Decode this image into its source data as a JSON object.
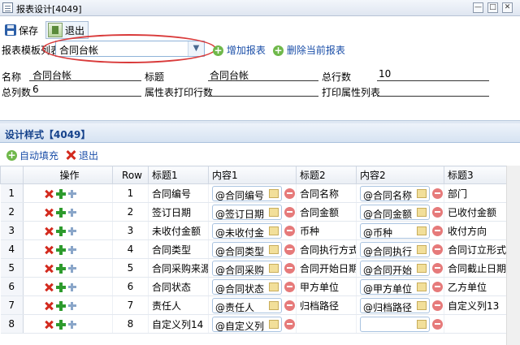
{
  "window": {
    "title": "报表设计[4049]",
    "controls": [
      "—",
      "□",
      "✕"
    ]
  },
  "toolbar": {
    "save_label": "保存",
    "exit_label": "退出"
  },
  "template": {
    "label": "报表模板列表",
    "selected": "合同台帐",
    "add_label": "增加报表",
    "delete_label": "删除当前报表"
  },
  "fields": {
    "name_label": "名称",
    "name_value": "合同台帐",
    "title_label": "标题",
    "title_value": "合同台帐",
    "total_rows_label": "总行数",
    "total_rows_value": "10",
    "total_cols_label": "总列数",
    "total_cols_value": "6",
    "prop_print_rows_label": "属性表打印行数",
    "prop_print_rows_value": "",
    "print_prop_list_label": "打印属性列表",
    "print_prop_list_value": ""
  },
  "design": {
    "header": "设计样式【4049】",
    "autofill_label": "自动填充",
    "exit_label": "退出",
    "columns": [
      "操作",
      "Row",
      "标题1",
      "内容1",
      "标题2",
      "内容2",
      "标题3"
    ],
    "rows": [
      {
        "n": "1",
        "row": "1",
        "t1": "合同编号",
        "c1": "@合同编号",
        "t2": "合同名称",
        "c2": "@合同名称",
        "t3": "部门"
      },
      {
        "n": "2",
        "row": "2",
        "t1": "签订日期",
        "c1": "@签订日期",
        "t2": "合同金额",
        "c2": "@合同金额",
        "t3": "已收付金额"
      },
      {
        "n": "3",
        "row": "3",
        "t1": "未收付金额",
        "c1": "@未收付金",
        "t2": "币种",
        "c2": "@币种",
        "t3": "收付方向"
      },
      {
        "n": "4",
        "row": "4",
        "t1": "合同类型",
        "c1": "@合同类型",
        "t2": "合同执行方式",
        "c2": "@合同执行",
        "t3": "合同订立形式"
      },
      {
        "n": "5",
        "row": "5",
        "t1": "合同采购来源",
        "c1": "@合同采购",
        "t2": "合同开始日期",
        "c2": "@合同开始",
        "t3": "合同截止日期"
      },
      {
        "n": "6",
        "row": "6",
        "t1": "合同状态",
        "c1": "@合同状态",
        "t2": "甲方单位",
        "c2": "@甲方单位",
        "t3": "乙方单位"
      },
      {
        "n": "7",
        "row": "7",
        "t1": "责任人",
        "c1": "@责任人",
        "t2": "归档路径",
        "c2": "@归档路径",
        "t3": "自定义列13"
      },
      {
        "n": "8",
        "row": "8",
        "t1": "自定义列14",
        "c1": "@自定义列",
        "t2": "",
        "c2": "",
        "t3": ""
      }
    ]
  }
}
